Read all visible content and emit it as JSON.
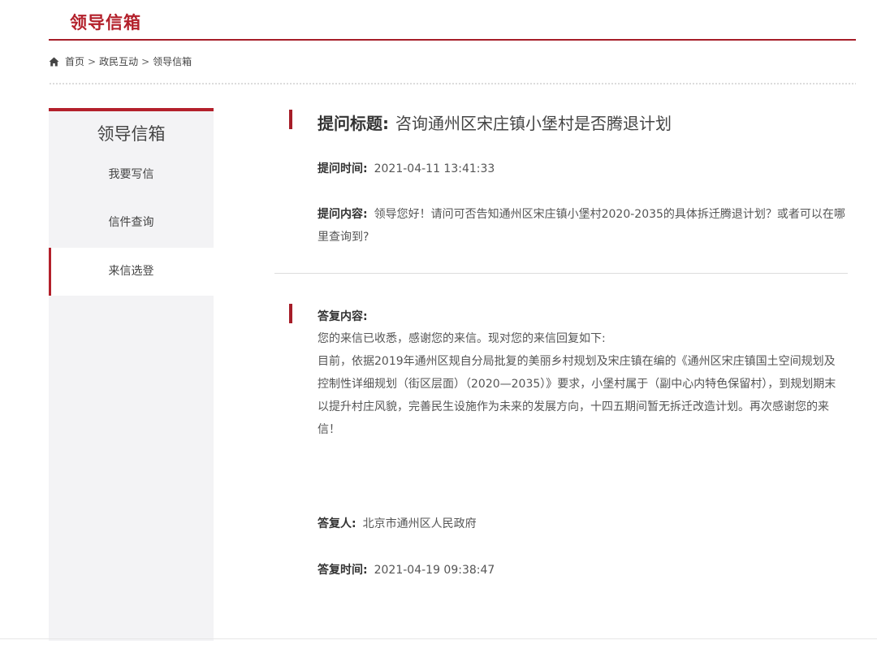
{
  "header": {
    "title": "领导信箱"
  },
  "breadcrumb": {
    "home_icon": "home-icon",
    "items": [
      "首页",
      "政民互动",
      "领导信箱"
    ],
    "separator": ">"
  },
  "sidebar": {
    "heading": "领导信箱",
    "items": [
      {
        "label": "我要写信"
      },
      {
        "label": "信件查询"
      },
      {
        "label": "来信选登",
        "active": true
      }
    ]
  },
  "question": {
    "title_label": "提问标题:",
    "title": "咨询通州区宋庄镇小堡村是否腾退计划",
    "time_label": "提问时间:",
    "time": "2021-04-11 13:41:33",
    "content_label": "提问内容:",
    "content": "领导您好！请问可否告知通州区宋庄镇小堡村2020-2035的具体拆迁腾退计划？或者可以在哪里查询到?"
  },
  "reply": {
    "content_label": "答复内容:",
    "paragraphs": [
      "您的来信已收悉，感谢您的来信。现对您的来信回复如下:",
      "目前，依据2019年通州区规自分局批复的美丽乡村规划及宋庄镇在编的《通州区宋庄镇国土空间规划及控制性详细规划（街区层面）（2020—2035）》要求，小堡村属于（副中心内特色保留村），到规划期末以提升村庄风貌，完善民生设施作为未来的发展方向，十四五期间暂无拆迁改造计划。再次感谢您的来信！"
    ],
    "by_label": "答复人:",
    "by": "北京市通州区人民政府",
    "time_label": "答复时间:",
    "time": "2021-04-19 09:38:47"
  },
  "colors": {
    "accent": "#b3202b",
    "sidebar_bg": "#f3f3f5"
  }
}
